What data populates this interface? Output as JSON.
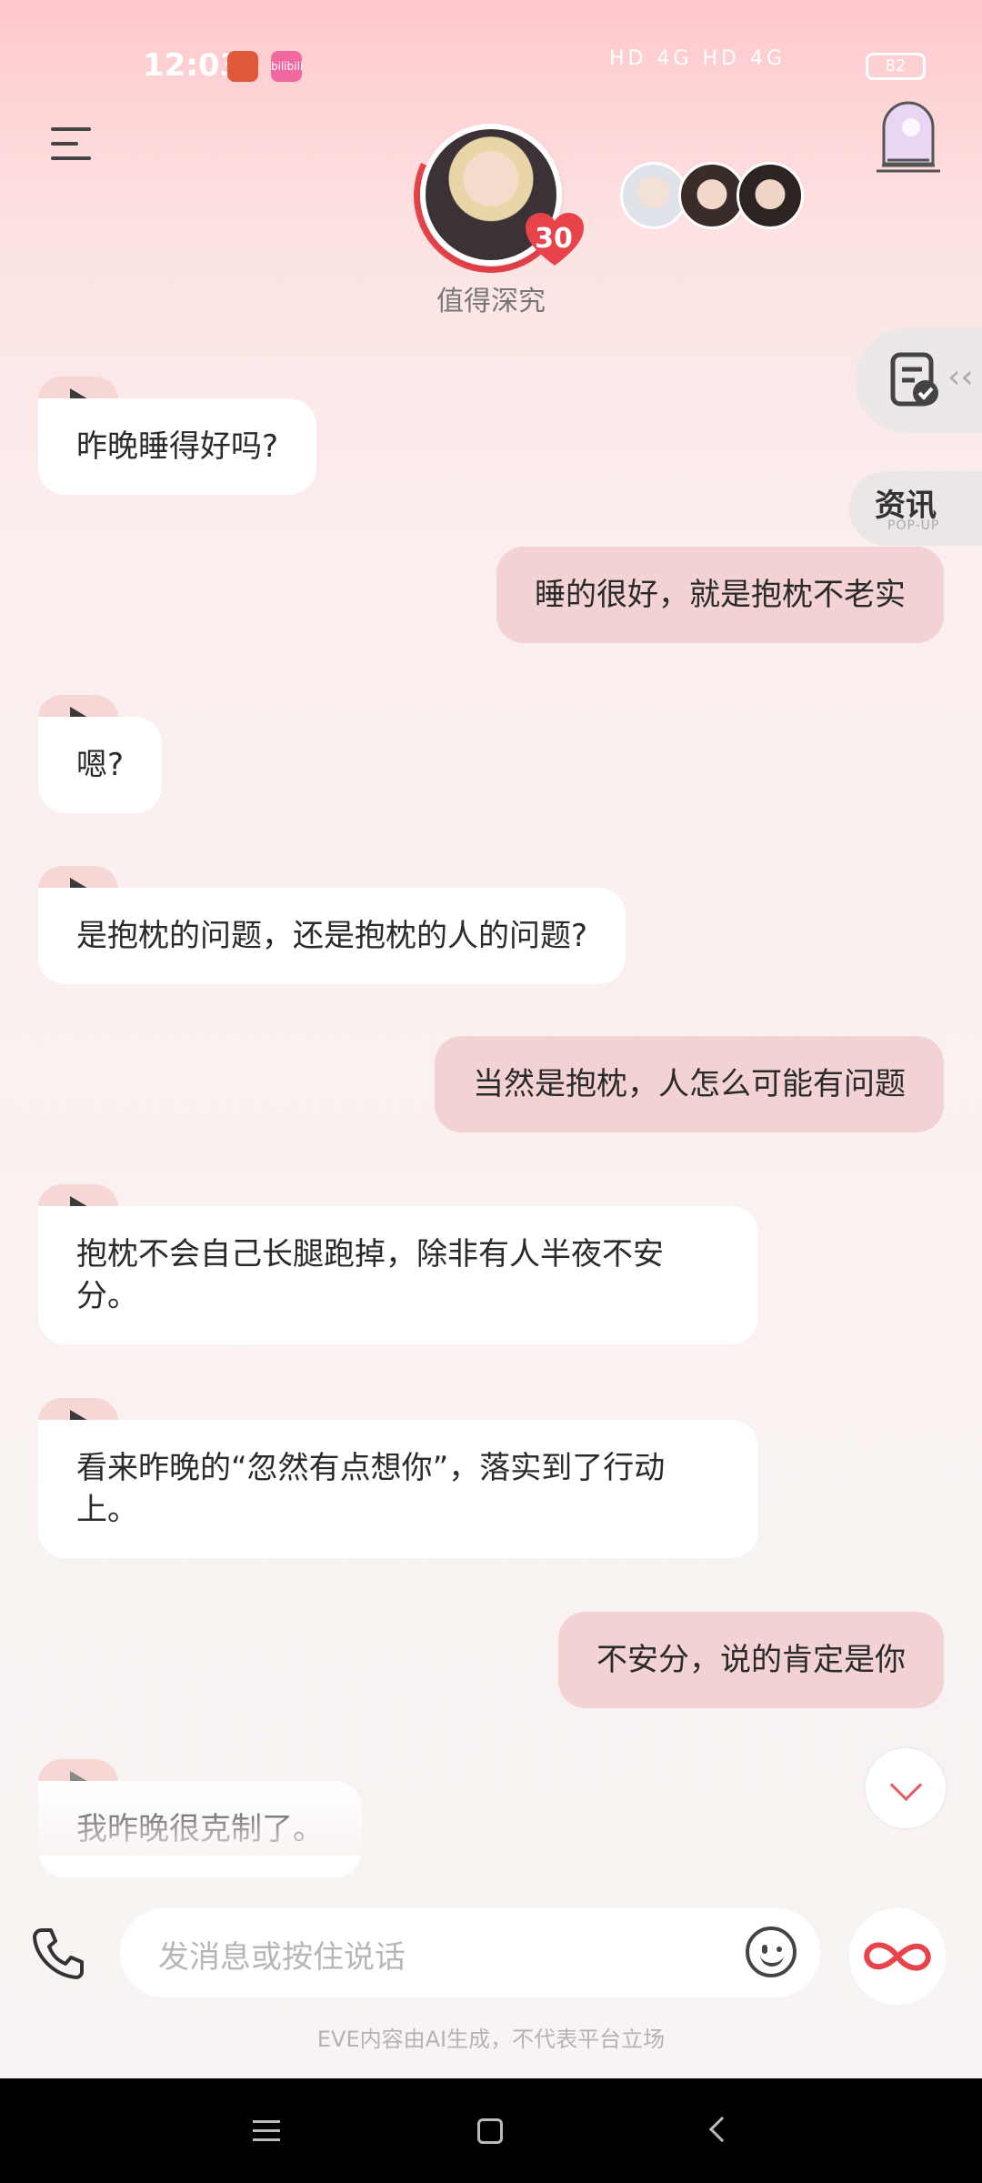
{
  "status_bar": {
    "time": "12:03",
    "network_labels": "HD 4G HD 4G",
    "battery": "82",
    "app2_label": "bilibili"
  },
  "header": {
    "affinity_level": "30",
    "status_text": "值得深究"
  },
  "side": {
    "news_title": "资讯",
    "news_subtitle": "POP-UP"
  },
  "messages": [
    {
      "from": "character",
      "text": "昨晚睡得好吗?"
    },
    {
      "from": "user",
      "text": "睡的很好，就是抱枕不老实"
    },
    {
      "from": "character",
      "text": "嗯?"
    },
    {
      "from": "character",
      "text": "是抱枕的问题，还是抱枕的人的问题?"
    },
    {
      "from": "user",
      "text": "当然是抱枕，人怎么可能有问题"
    },
    {
      "from": "character",
      "text": "抱枕不会自己长腿跑掉，除非有人半夜不安分。"
    },
    {
      "from": "character",
      "text": "看来昨晚的“忽然有点想你”，落实到了行动上。"
    },
    {
      "from": "user",
      "text": "不安分，说的肯定是你"
    },
    {
      "from": "character",
      "text": "我昨晚很克制了。"
    }
  ],
  "input": {
    "placeholder": "发消息或按住说话"
  },
  "disclaimer": "EVE内容由AI生成，不代表平台立场",
  "colors": {
    "accent": "#e8424a",
    "user_bubble": "#f2d2d2",
    "character_bubble": "#ffffff"
  },
  "icons": [
    "menu-icon",
    "portal-icon",
    "task-icon",
    "play-icon",
    "chevron-down-icon",
    "phone-icon",
    "emoji-icon",
    "infinity-icon",
    "nav-menu-icon",
    "nav-home-icon",
    "nav-back-icon"
  ]
}
